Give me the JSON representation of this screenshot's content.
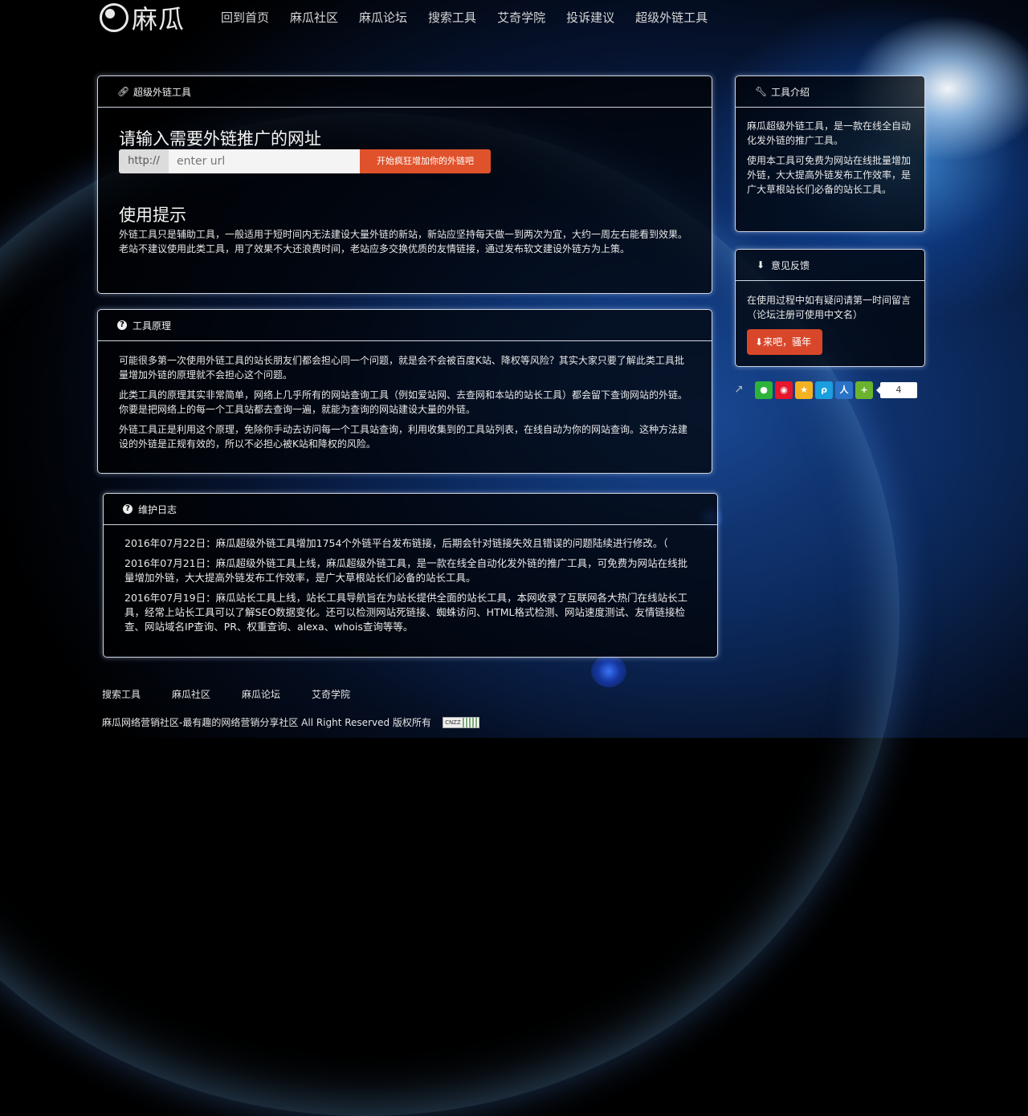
{
  "header": {
    "logo_text": "麻瓜",
    "nav": [
      "回到首页",
      "麻瓜社区",
      "麻瓜论坛",
      "搜索工具",
      "艾奇学院",
      "投诉建议",
      "超级外链工具"
    ]
  },
  "main_panel": {
    "title": "超级外链工具",
    "heading": "请输入需要外链推广的网址",
    "url_prefix": "http://",
    "url_placeholder": "enter url",
    "submit_label": "开始疯狂增加你的外链吧",
    "tips_heading": "使用提示",
    "tips_text": "外链工具只是辅助工具，一般适用于短时间内无法建设大量外链的新站，新站应坚持每天做一到两次为宜，大约一周左右能看到效果。老站不建议使用此类工具，用了效果不大还浪费时间，老站应多交换优质的友情链接，通过发布软文建设外链方为上策。"
  },
  "principle_panel": {
    "title": "工具原理",
    "paragraphs": [
      "可能很多第一次使用外链工具的站长朋友们都会担心同一个问题，就是会不会被百度K站、降权等风险？其实大家只要了解此类工具批量增加外链的原理就不会担心这个问题。",
      "此类工具的原理其实非常简单，网络上几乎所有的网站查询工具（例如爱站网、去查网和本站的站长工具）都会留下查询网站的外链。你要是把网络上的每一个工具站都去查询一遍，就能为查询的网站建设大量的外链。",
      "外链工具正是利用这个原理，免除你手动去访问每一个工具站查询，利用收集到的工具站列表，在线自动为你的网站查询。这种方法建设的外链是正规有效的，所以不必担心被K站和降权的风险。"
    ]
  },
  "log_panel": {
    "title": "维护日志",
    "entries": [
      "2016年07月22日：麻瓜超级外链工具增加1754个外链平台发布链接，后期会针对链接失效且错误的问题陆续进行修改。（",
      "2016年07月21日：麻瓜超级外链工具上线，麻瓜超级外链工具，是一款在线全自动化发外链的推广工具，可免费为网站在线批量增加外链，大大提高外链发布工作效率，是广大草根站长们必备的站长工具。",
      "2016年07月19日：麻瓜站长工具上线，站长工具导航旨在为站长提供全面的站长工具，本网收录了互联网各大热门在线站长工具，经常上站长工具可以了解SEO数据变化。还可以检测网站死链接、蜘蛛访问、HTML格式检测、网站速度测试、友情链接检查、网站域名IP查询、PR、权重查询、alexa、whois查询等等。"
    ]
  },
  "intro_panel": {
    "title": "工具介绍",
    "paragraphs": [
      "麻瓜超级外链工具，是一款在线全自动化发外链的推广工具。",
      "使用本工具可免费为网站在线批量增加外链，大大提高外链发布工作效率，是广大草根站长们必备的站长工具。"
    ]
  },
  "feedback_panel": {
    "title": "意见反馈",
    "text": "在使用过程中如有疑问请第一时间留言（论坛注册可使用中文名）",
    "button_label": "来吧，骚年"
  },
  "share": {
    "count": "4",
    "icons": [
      "wechat-icon",
      "weibo-icon",
      "qzone-icon",
      "tencent-weibo-icon",
      "renren-icon",
      "more-icon"
    ],
    "colors": [
      "#2db33a",
      "#e6162d",
      "#f3b221",
      "#1a9ee0",
      "#2a72c7",
      "#6ab42d"
    ]
  },
  "footer": {
    "links": [
      "搜索工具",
      "麻瓜社区",
      "麻瓜论坛",
      "艾奇学院"
    ],
    "copyright": "麻瓜网络营销社区-最有趣的网络营销分享社区 All Right Reserved 版权所有",
    "badge_text": "CNZZ"
  }
}
